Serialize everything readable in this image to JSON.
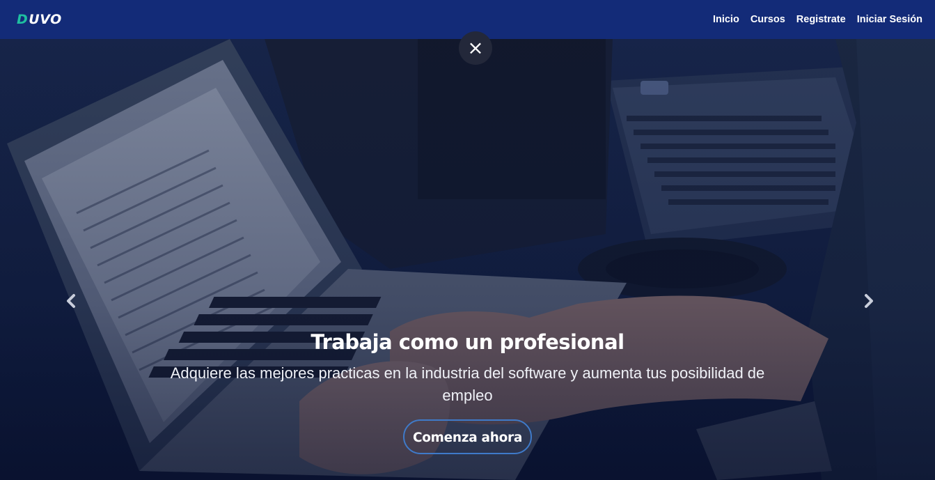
{
  "brand": {
    "letter": "D",
    "rest": "UVO"
  },
  "nav": {
    "items": [
      {
        "label": "Inicio"
      },
      {
        "label": "Cursos"
      },
      {
        "label": "Registrate"
      },
      {
        "label": "Iniciar Sesión"
      }
    ]
  },
  "hero": {
    "close_symbol": "×",
    "title": "Trabaja como un profesional",
    "subtitle": "Adquiere las mejores practicas en la industria del software y aumenta tus posibilidad de empleo",
    "cta_label": "Comenza ahora",
    "prev_icon": "chevron-left-icon",
    "next_icon": "chevron-right-icon"
  },
  "colors": {
    "navbar": "#132b78",
    "brand_accent": "#1fbfa0",
    "cta_border": "#3f7ac9",
    "close_button": "#23283a"
  }
}
